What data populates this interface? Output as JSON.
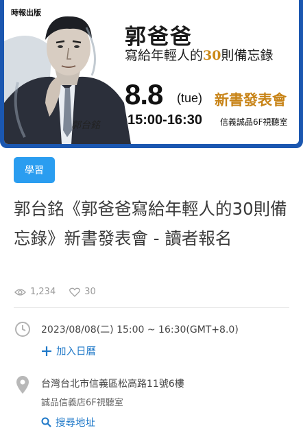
{
  "banner": {
    "publisher": "時報出版",
    "signature": "郭台銘",
    "book_title": "郭爸爸",
    "book_subtitle_pre": "寫給年輕人的",
    "book_subtitle_num": "30",
    "book_subtitle_post": "則備忘錄",
    "date": "8.8",
    "weekday": "(tue)",
    "launch": "新書發表會",
    "time": "15:00-16:30",
    "venue": "信義誠品6F視聽室"
  },
  "event": {
    "category": "學習",
    "title": "郭台銘《郭爸爸寫給年輕人的30則備忘錄》新書發表會 - 讀者報名",
    "views": "1,234",
    "likes": "30",
    "datetime": "2023/08/08(二) 15:00 ~ 16:30(GMT+8.0)",
    "add_calendar": "加入日曆",
    "address": "台灣台北市信義區松高路11號6樓",
    "venue": "誠品信義店6F視聽室",
    "search_address": "搜尋地址"
  },
  "colors": {
    "banner_border": "#1b57b0",
    "tag_bg": "#2a9df0",
    "link": "#1e78c8",
    "accent_gold": "#c88418"
  }
}
